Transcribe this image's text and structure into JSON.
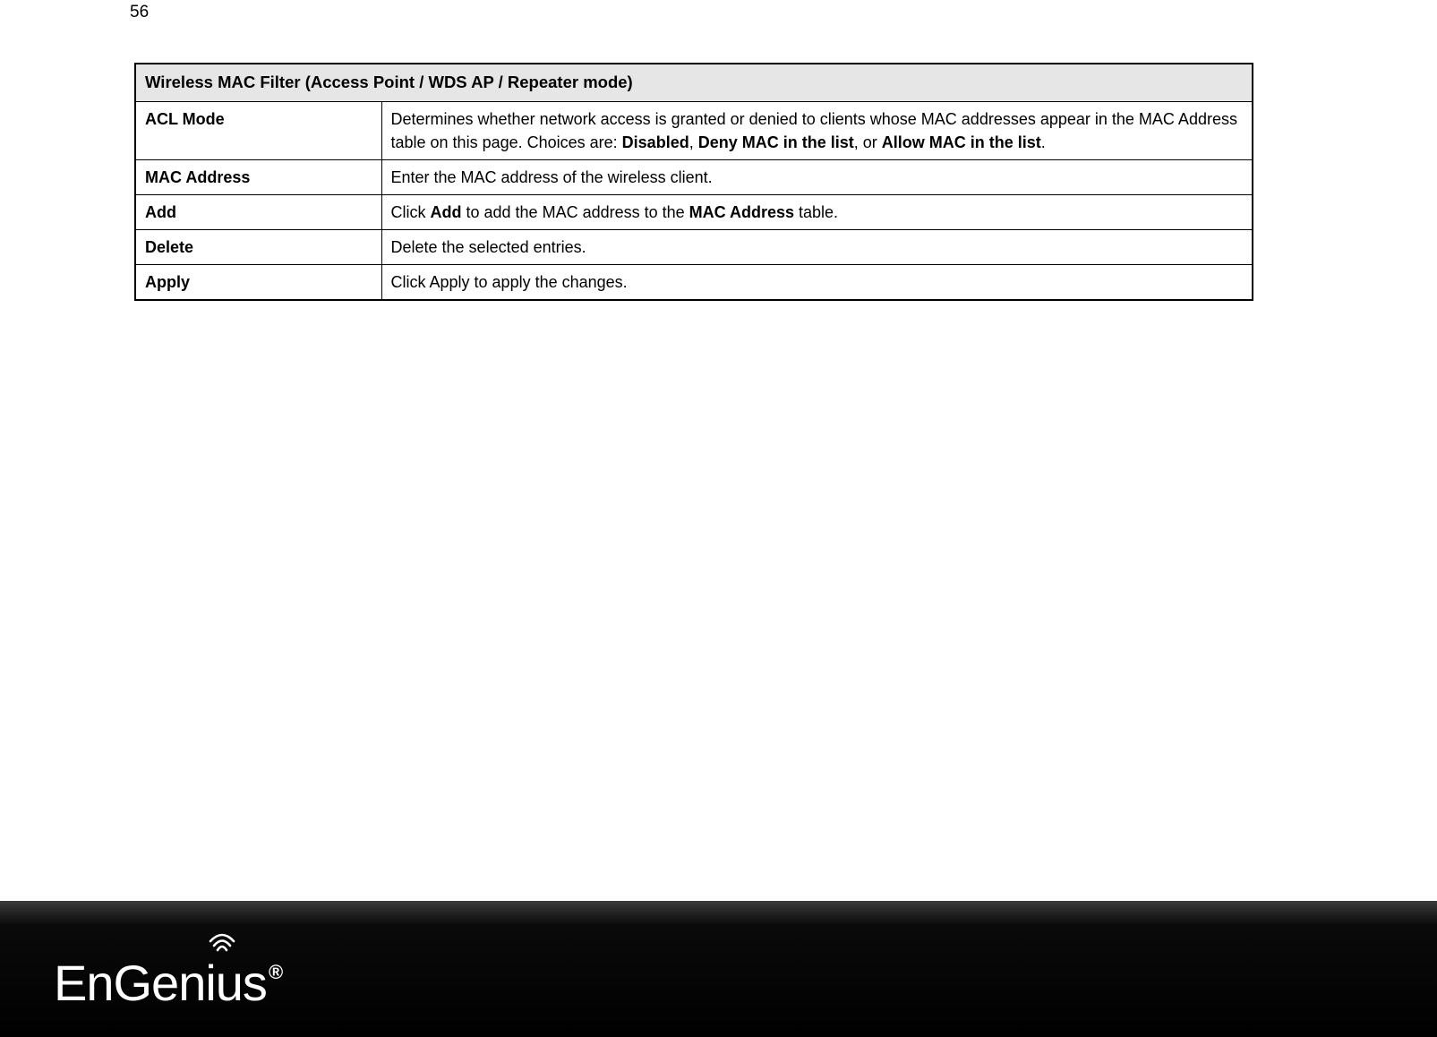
{
  "page_number": "56",
  "table": {
    "header": "Wireless MAC Filter (Access Point / WDS AP / Repeater mode)",
    "rows": [
      {
        "label": "ACL Mode",
        "desc_parts": [
          {
            "t": "Determines whether network access is granted or denied to clients whose MAC addresses appear in the MAC Address table on this page. Choices are: ",
            "b": false
          },
          {
            "t": "Disabled",
            "b": true
          },
          {
            "t": ", ",
            "b": false
          },
          {
            "t": "Deny MAC in the list",
            "b": true
          },
          {
            "t": ", or ",
            "b": false
          },
          {
            "t": "Allow MAC in the list",
            "b": true
          },
          {
            "t": ".",
            "b": false
          }
        ]
      },
      {
        "label": "MAC Address",
        "desc_parts": [
          {
            "t": "Enter the MAC address of the wireless client.",
            "b": false
          }
        ]
      },
      {
        "label": "Add",
        "desc_parts": [
          {
            "t": "Click ",
            "b": false
          },
          {
            "t": "Add",
            "b": true
          },
          {
            "t": " to add the MAC address to the ",
            "b": false
          },
          {
            "t": "MAC Address",
            "b": true
          },
          {
            "t": " table.",
            "b": false
          }
        ]
      },
      {
        "label": "Delete",
        "desc_parts": [
          {
            "t": "Delete the selected entries.",
            "b": false
          }
        ]
      },
      {
        "label": "Apply",
        "desc_parts": [
          {
            "t": "Click Apply to apply the changes.",
            "b": false
          }
        ]
      }
    ]
  },
  "footer": {
    "brand_a": "EnGen",
    "brand_b": "ius",
    "registered": "®"
  }
}
